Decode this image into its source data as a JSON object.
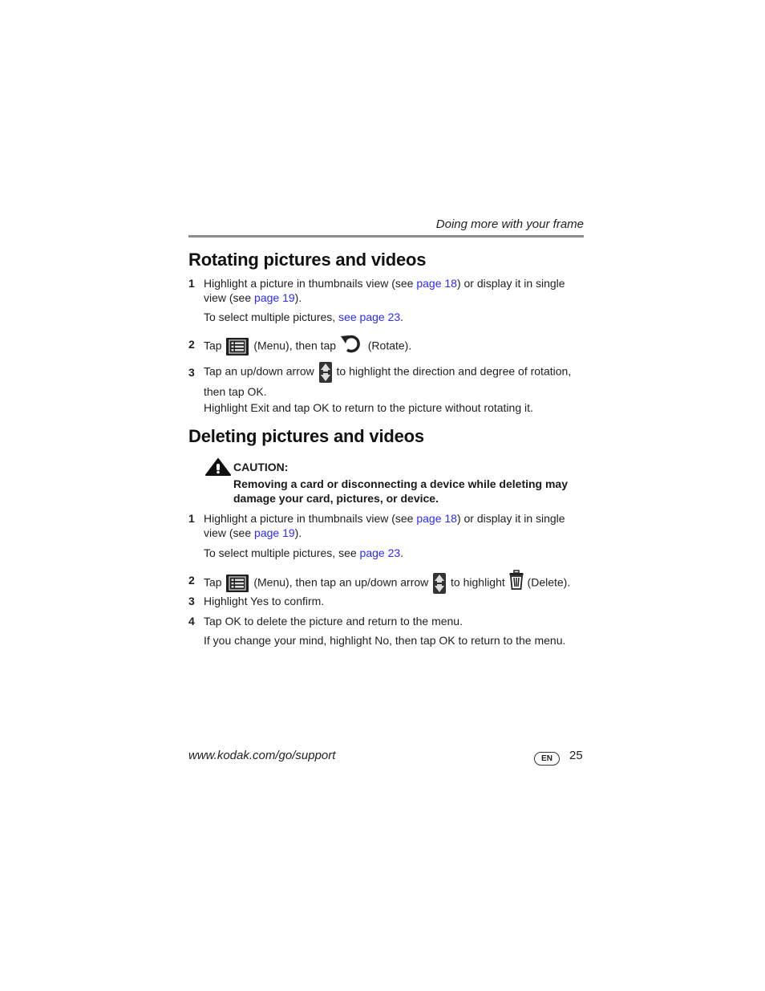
{
  "header": {
    "section_title": "Doing more with your frame"
  },
  "rotate": {
    "heading": "Rotating pictures and videos",
    "step1": {
      "num": "1",
      "pre": "Highlight a picture in thumbnails view (see ",
      "link1": "page 18",
      "mid": ") or display it in single view (see ",
      "link2": "page 19",
      "post": ")."
    },
    "note1": {
      "pre": "To select multiple pictures, ",
      "link": "see page 23",
      "post": "."
    },
    "step2": {
      "num": "2",
      "pre": "Tap",
      "mid": "(Menu), then tap",
      "post": "(Rotate)."
    },
    "step3": {
      "num": "3",
      "pre": "Tap an up/down arrow",
      "post": "to highlight the direction and degree of rotation, then tap OK."
    },
    "note3": "Highlight Exit and tap OK to return to the picture without rotating it."
  },
  "delete": {
    "heading": "Deleting pictures and videos",
    "caution_title": "CAUTION:",
    "caution_body": "Removing a card or disconnecting a device while deleting may damage your card, pictures, or device.",
    "step1": {
      "num": "1",
      "pre": "Highlight a picture in thumbnails view (see ",
      "link1": "page 18",
      "mid": ") or display it in single view (see ",
      "link2": "page 19",
      "post": ")."
    },
    "note1": {
      "pre": "To select multiple pictures, see ",
      "link": "page 23",
      "post": "."
    },
    "step2": {
      "num": "2",
      "pre": "Tap",
      "mid": "(Menu), then tap an up/down arrow",
      "mid2": "to highlight",
      "post": "(Delete)."
    },
    "step3": {
      "num": "3",
      "text": "Highlight Yes to confirm."
    },
    "step4": {
      "num": "4",
      "text": "Tap OK to delete the picture and return to the menu."
    },
    "note4": "If you change your mind, highlight No, then tap OK to return to the menu."
  },
  "footer": {
    "url": "www.kodak.com/go/support",
    "lang_badge": "EN",
    "page_number": "25"
  },
  "colors": {
    "link": "#2a2aff",
    "rule": "#8c8c8c"
  }
}
